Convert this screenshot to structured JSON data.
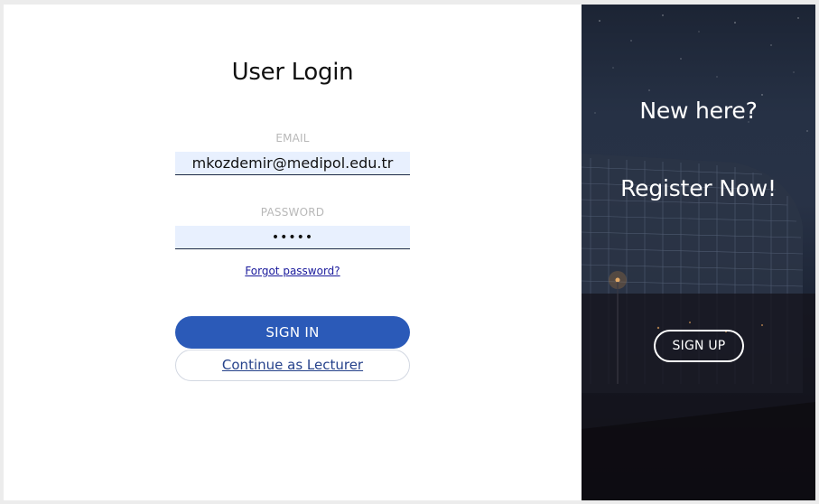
{
  "login": {
    "title": "User Login",
    "email_label": "EMAIL",
    "email_value": "mkozdemir@medipol.edu.tr",
    "password_label": "PASSWORD",
    "password_value": "•••••",
    "forgot_password": "Forgot password?",
    "sign_in_label": "SIGN IN",
    "continue_lecturer_label": "Continue as Lecturer"
  },
  "register": {
    "heading": "New here?",
    "subheading": "Register Now!",
    "sign_up_label": "SIGN UP"
  },
  "colors": {
    "primary_button": "#2b5ab8",
    "input_background": "#e8f0fe",
    "link": "#1a1a9c",
    "panel_dark": "#1e2637"
  }
}
